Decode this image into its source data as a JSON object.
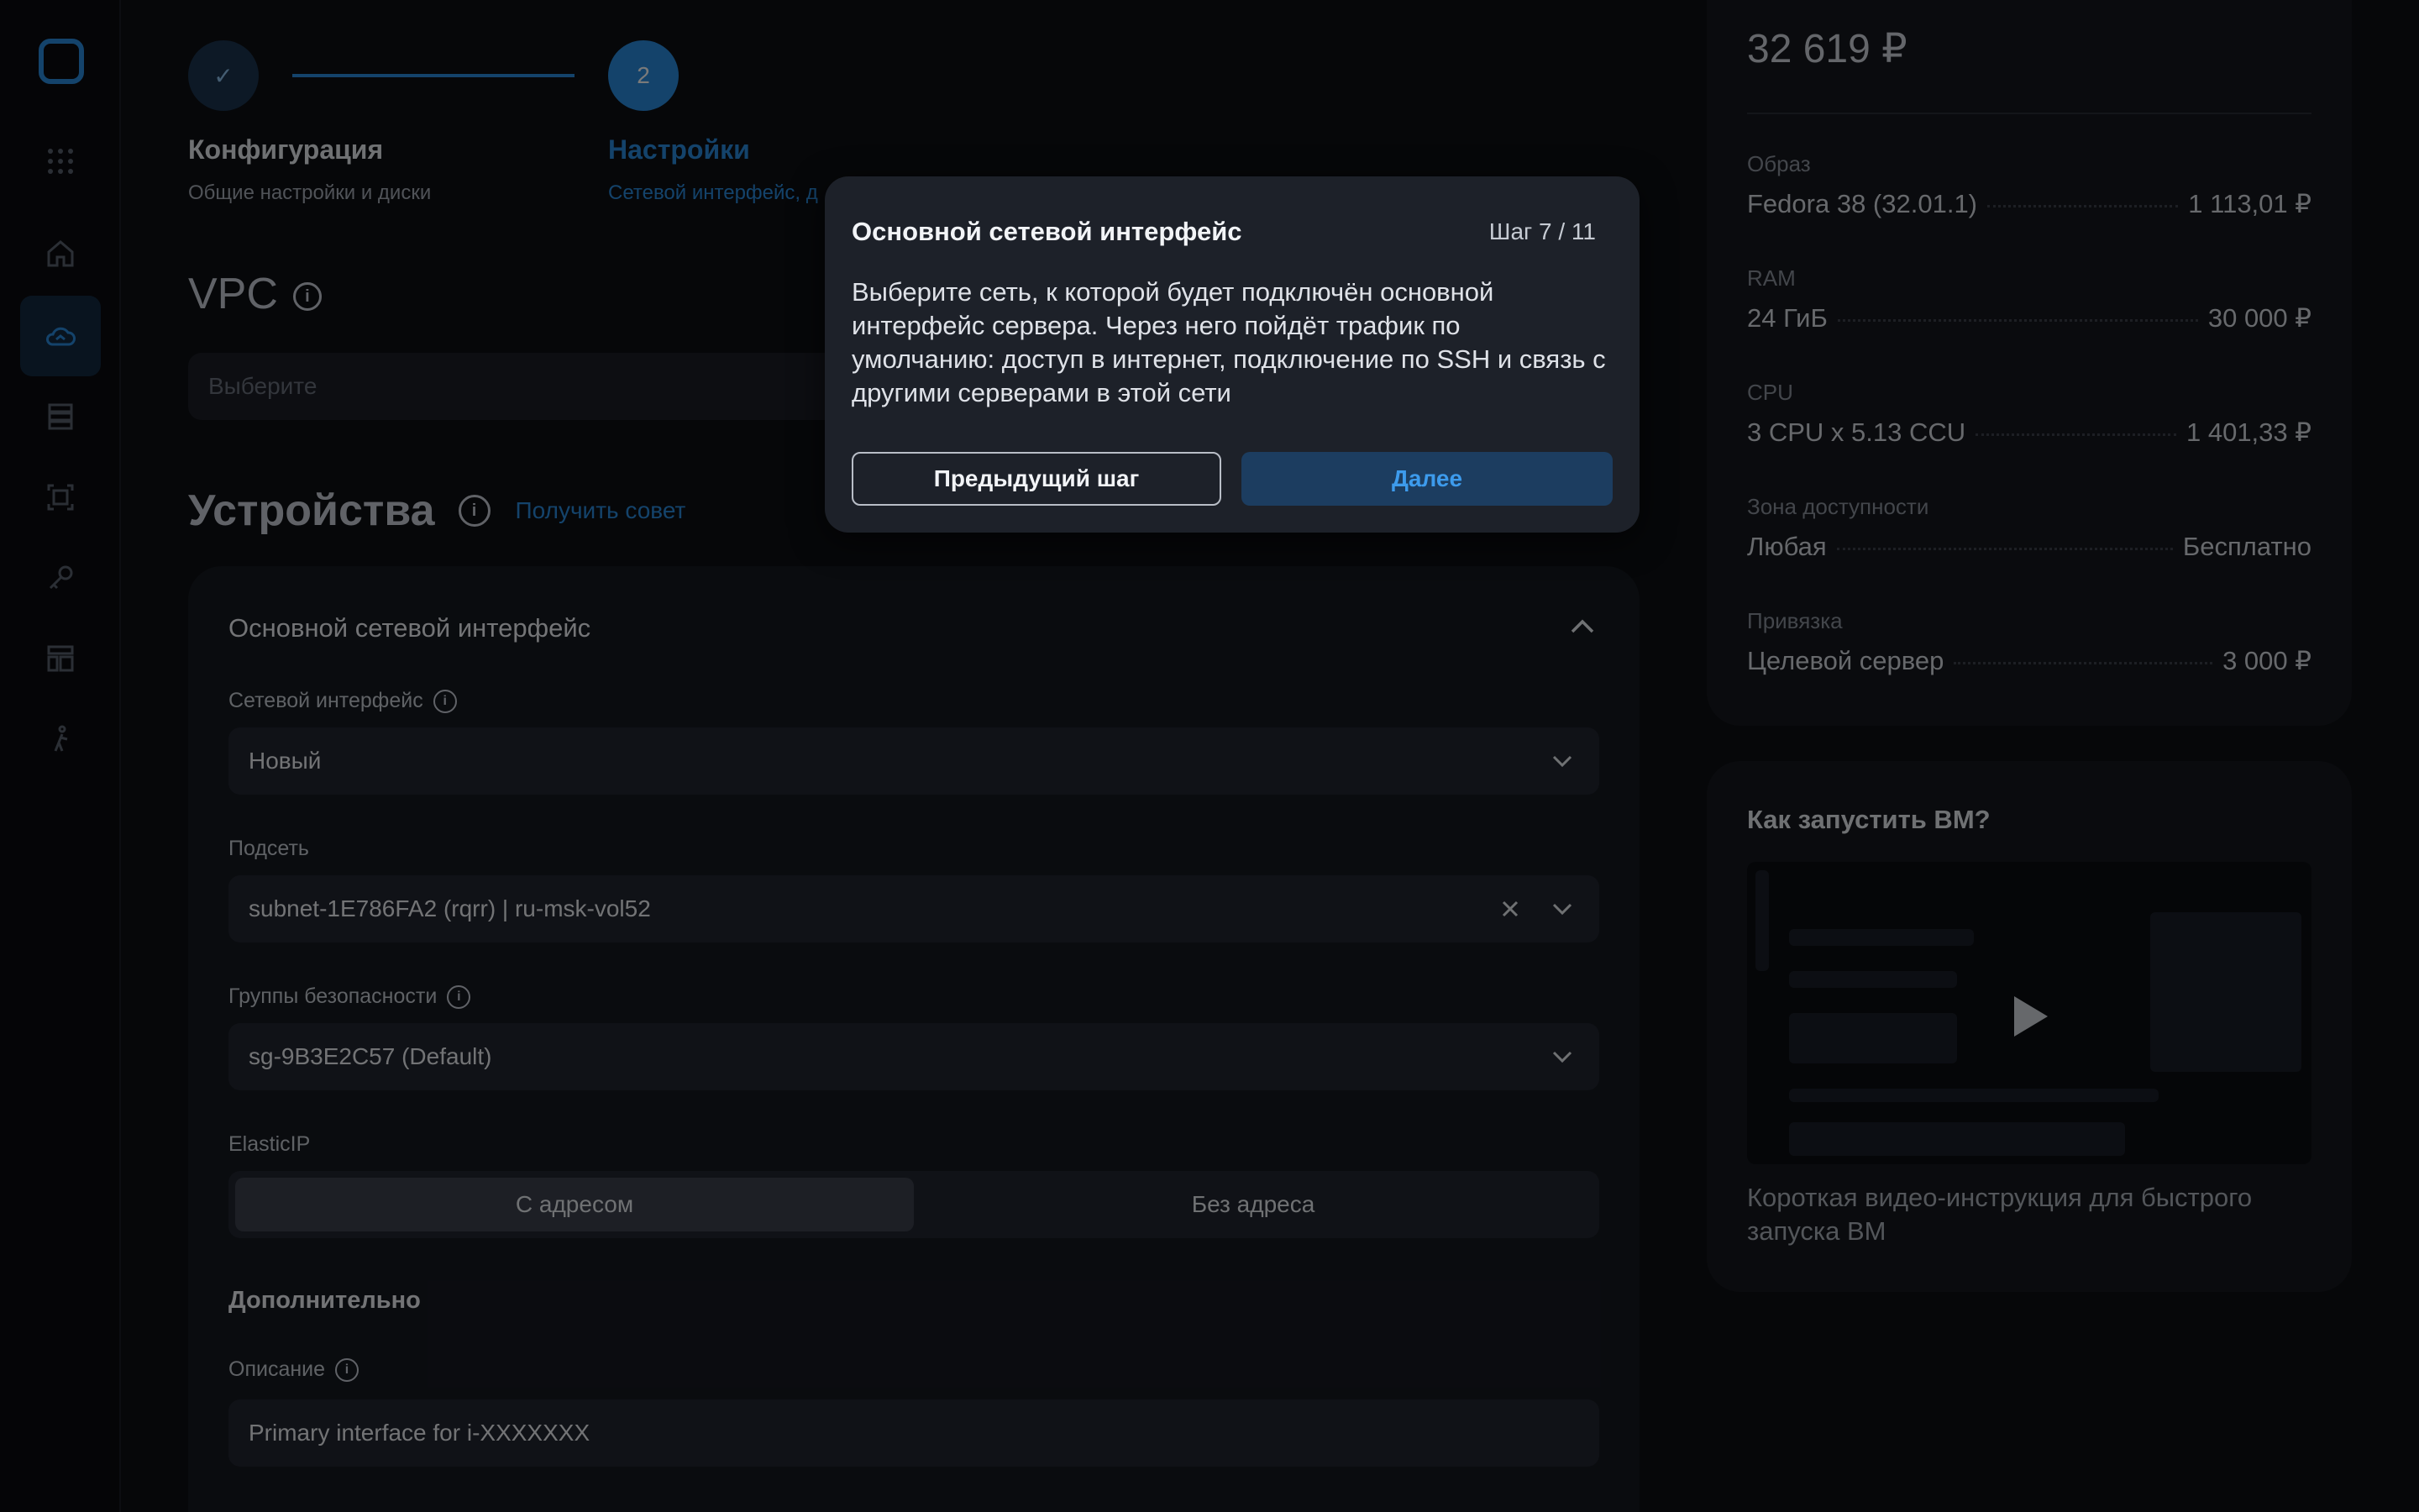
{
  "stepper": {
    "step1": {
      "icon": "✓",
      "title": "Конфигурация",
      "subtitle": "Общие настройки и диски"
    },
    "step2": {
      "number": "2",
      "title": "Настройки",
      "subtitle": "Сетевой интерфейс, д"
    }
  },
  "vpc": {
    "title": "VPC",
    "placeholder": "Выберите"
  },
  "devices": {
    "title": "Устройства",
    "tip_link": "Получить совет"
  },
  "interface_card": {
    "title": "Основной сетевой интерфейс",
    "network_interface": {
      "label": "Сетевой интерфейс",
      "value": "Новый"
    },
    "subnet": {
      "label": "Подсеть",
      "value": "subnet-1E786FA2 (rqrr) | ru-msk-vol52"
    },
    "security_groups": {
      "label": "Группы безопасности",
      "value": "sg-9B3E2C57 (Default)"
    },
    "elastic_ip": {
      "label": "ElasticIP",
      "options": [
        "С адресом",
        "Без адреса"
      ],
      "selected": "С адресом"
    },
    "additional_title": "Дополнительно",
    "description": {
      "label": "Описание",
      "value": "Primary interface for i-XXXXXXX"
    }
  },
  "summary": {
    "total": "32 619 ₽",
    "rows": [
      {
        "label": "Образ",
        "name": "Fedora 38 (32.01.1)",
        "price": "1 113,01 ₽"
      },
      {
        "label": "RAM",
        "name": "24 ГиБ",
        "price": "30 000 ₽"
      },
      {
        "label": "CPU",
        "name": "3 CPU x 5.13 CCU",
        "price": "1 401,33 ₽"
      },
      {
        "label": "Зона доступности",
        "name": "Любая",
        "price": "Бесплатно"
      },
      {
        "label": "Привязка",
        "name": "Целевой сервер",
        "price": "3 000 ₽"
      }
    ]
  },
  "video_card": {
    "title": "Как запустить ВМ?",
    "description": "Короткая видео-инструкция для быстрого запуска ВМ"
  },
  "popover": {
    "title": "Основной сетевой интерфейс",
    "step": "Шаг 7 / 11",
    "text": "Выберите сеть, к которой будет подключён основной интерфейс сервера. Через него пойдёт трафик по умолчанию: доступ в интернет, подключение по SSH и связь с другими серверами в этой сети",
    "prev_label": "Предыдущий шаг",
    "next_label": "Далее"
  },
  "colors": {
    "accent": "#2b8de0",
    "background": "#0d0f13",
    "card": "#161921"
  }
}
